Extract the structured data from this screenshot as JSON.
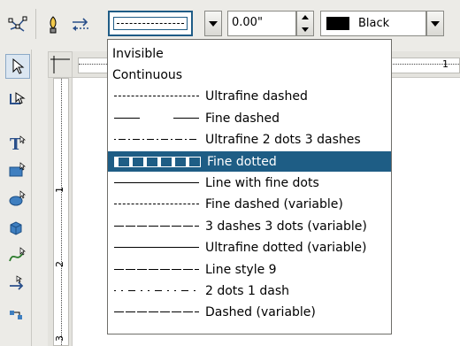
{
  "toolbar": {
    "line_width": "0.00\"",
    "line_color": "Black",
    "colors": {
      "selection": "#1e5d85",
      "focus": "#1f5c86"
    }
  },
  "left_toolbar": {
    "icons": [
      "select-arrow-icon",
      "points-icon",
      "text-icon",
      "rectangle-icon",
      "ellipse-icon",
      "3d-object-icon",
      "curve-icon",
      "connector-arrow-icon",
      "glue-points-icon"
    ]
  },
  "rulers": {
    "h_marks": [
      "1"
    ],
    "v_marks": [
      "1",
      "2",
      "3"
    ]
  },
  "line_styles": [
    {
      "label": "Invisible",
      "sample": "none",
      "selected": false
    },
    {
      "label": "Continuous",
      "sample": "none",
      "selected": false
    },
    {
      "label": "Ultrafine dashed",
      "sample": "ultrafine-dashed",
      "selected": false
    },
    {
      "label": "Fine dashed",
      "sample": "fine-dashed",
      "selected": false
    },
    {
      "label": "Ultrafine 2 dots 3 dashes",
      "sample": "dots-dashes",
      "selected": false
    },
    {
      "label": "Fine dotted",
      "sample": "fine-dotted",
      "selected": true
    },
    {
      "label": "Line with fine dots",
      "sample": "solid",
      "selected": false
    },
    {
      "label": "Fine dashed (variable)",
      "sample": "ultrafine-dashed",
      "selected": false
    },
    {
      "label": "3 dashes 3 dots (variable)",
      "sample": "long-dashed",
      "selected": false
    },
    {
      "label": "Ultrafine dotted (variable)",
      "sample": "solid",
      "selected": false
    },
    {
      "label": "Line style 9",
      "sample": "long-dashed",
      "selected": false
    },
    {
      "label": "2 dots 1 dash",
      "sample": "dot-dash",
      "selected": false
    },
    {
      "label": "Dashed (variable)",
      "sample": "long-dashed",
      "selected": false
    }
  ]
}
